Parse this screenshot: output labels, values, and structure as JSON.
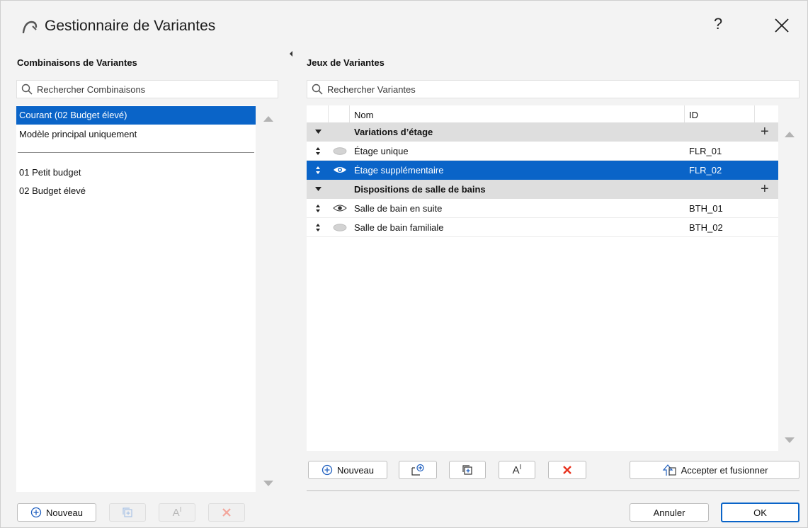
{
  "window": {
    "title": "Gestionnaire de Variantes",
    "help": "?",
    "icons": {
      "app": "arch-icon",
      "close": "close-icon"
    }
  },
  "left": {
    "heading": "Combinaisons de Variantes",
    "search_placeholder": "Rechercher Combinaisons",
    "items_top": [
      {
        "label": "Courant (02 Budget élevé)",
        "selected": true
      },
      {
        "label": "Modèle principal uniquement",
        "selected": false
      }
    ],
    "items_bottom": [
      {
        "label": "01 Petit budget"
      },
      {
        "label": "02 Budget élevé"
      }
    ],
    "buttons": {
      "new_label": "Nouveau",
      "rename_glyph": "A",
      "rename_sup": "I"
    }
  },
  "right": {
    "heading": "Jeux de Variantes",
    "search_placeholder": "Rechercher Variantes",
    "columns": {
      "name": "Nom",
      "id": "ID"
    },
    "groups": [
      {
        "name": "Variations d’étage",
        "rows": [
          {
            "name": "Étage unique",
            "id": "FLR_01",
            "visible": false,
            "selected": false
          },
          {
            "name": "Étage supplémentaire",
            "id": "FLR_02",
            "visible": true,
            "selected": true
          }
        ]
      },
      {
        "name": "Dispositions de salle de bains",
        "rows": [
          {
            "name": "Salle de bain en suite",
            "id": "BTH_01",
            "visible": true,
            "selected": false
          },
          {
            "name": "Salle de bain familiale",
            "id": "BTH_02",
            "visible": false,
            "selected": false
          }
        ]
      }
    ],
    "add_glyph": "+",
    "buttons": {
      "new_label": "Nouveau",
      "rename_glyph": "A",
      "rename_sup": "I",
      "merge_label": "Accepter et fusionner"
    }
  },
  "footer": {
    "cancel_label": "Annuler",
    "ok_label": "OK"
  },
  "colors": {
    "selection": "#0a64c8",
    "delete": "#e8321e",
    "group_bg": "#dedede"
  }
}
